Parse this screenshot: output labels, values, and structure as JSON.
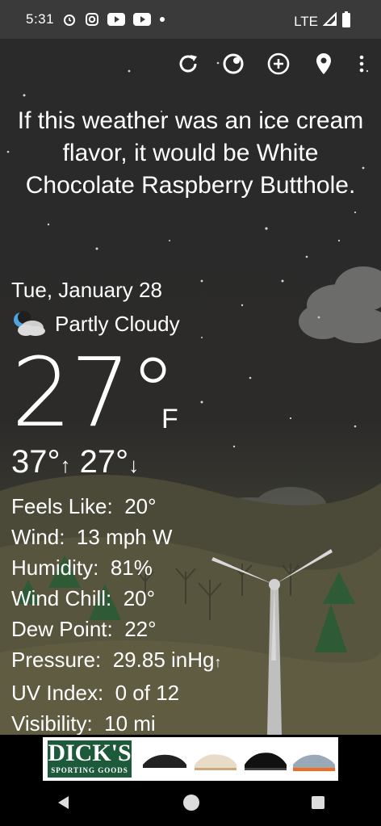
{
  "status_bar": {
    "time": "5:31",
    "network": "LTE"
  },
  "headline": "If this weather was an ice cream flavor, it would be White Chocolate Raspberry Butthole.",
  "weather": {
    "date": "Tue, January 28",
    "condition": "Partly Cloudy",
    "condition_icon": "partly-cloudy-night-icon",
    "temperature": "27°",
    "unit": "F",
    "high": "37°",
    "low": "27°"
  },
  "details": [
    {
      "label": "Feels Like:",
      "value": "20°"
    },
    {
      "label": "Wind:",
      "value": "13 mph W"
    },
    {
      "label": "Humidity:",
      "value": "81%"
    },
    {
      "label": "Wind Chill:",
      "value": "20°"
    },
    {
      "label": "Dew Point:",
      "value": "22°"
    },
    {
      "label": "Pressure:",
      "value": "29.85 inHg"
    },
    {
      "label": "UV Index:",
      "value": "0 of 12"
    },
    {
      "label": "Visibility:",
      "value": "10 mi"
    }
  ],
  "ad": {
    "brand": "DICK'S",
    "tagline": "SPORTING GOODS"
  },
  "colors": {
    "status_bar": "#3a3a3a",
    "sky": "#2a2a2a",
    "ad_green": "#1d5a3a"
  }
}
